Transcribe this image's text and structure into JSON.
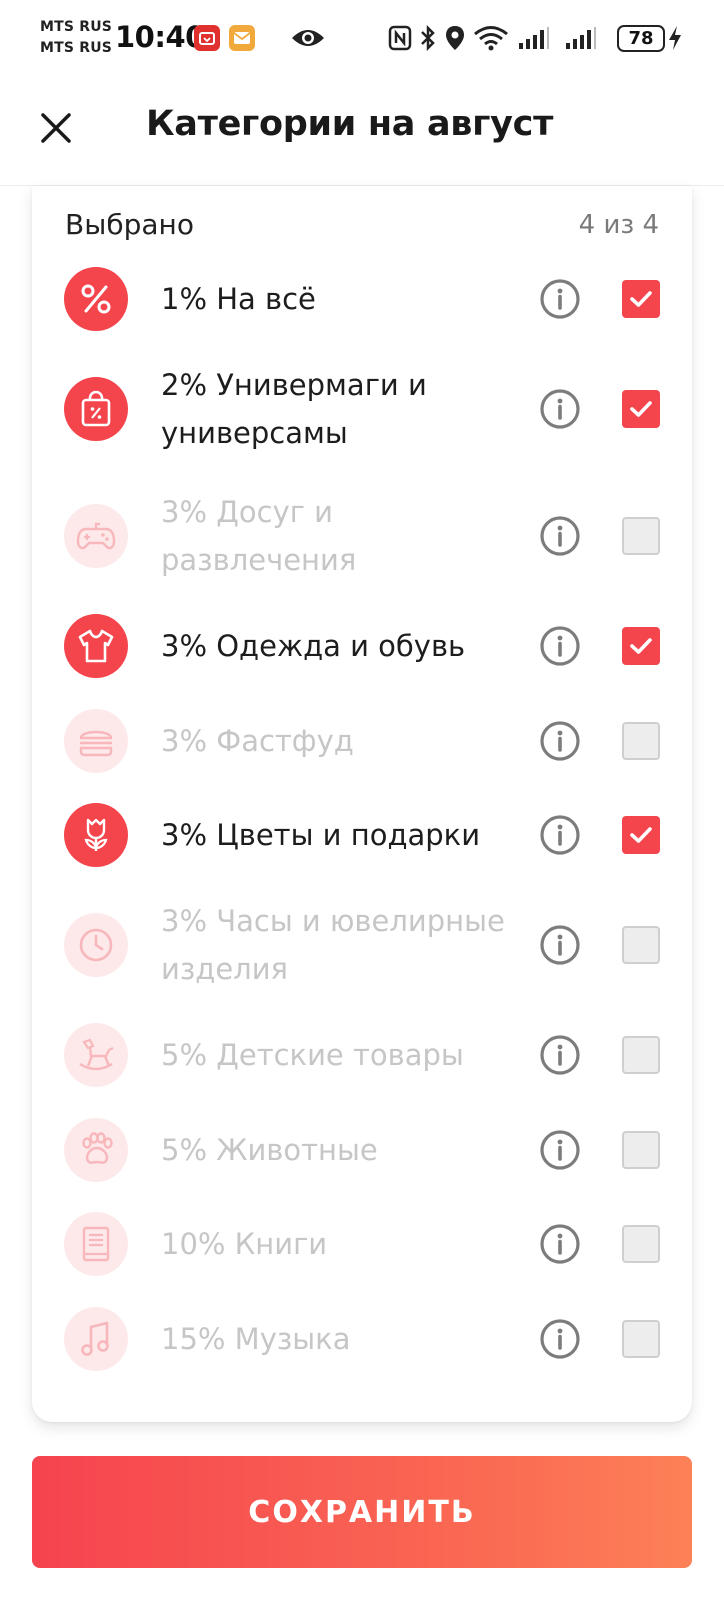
{
  "status_bar": {
    "carrier_1": "MTS RUS",
    "carrier_2": "MTS RUS",
    "time": "10:40",
    "battery": "78",
    "icons": [
      "mtapp-notification-icon",
      "mail-notification-icon",
      "eye-icon",
      "nfc-icon",
      "bluetooth-icon",
      "location-icon",
      "wifi-icon",
      "signal-icon",
      "signal-icon",
      "charging-icon"
    ]
  },
  "header": {
    "title": "Категории на август",
    "close_icon": "close-icon"
  },
  "selection": {
    "label": "Выбрано",
    "count": "4 из 4"
  },
  "categories": [
    {
      "label": "1% На всё",
      "icon": "percent-icon",
      "checked": true
    },
    {
      "label": "2% Универмаги и универсамы",
      "icon": "shopping-bag-icon",
      "checked": true
    },
    {
      "label": "3% Досуг и развлечения",
      "icon": "gamepad-icon",
      "checked": false
    },
    {
      "label": "3% Одежда и обувь",
      "icon": "tshirt-icon",
      "checked": true
    },
    {
      "label": "3% Фастфуд",
      "icon": "burger-icon",
      "checked": false
    },
    {
      "label": "3% Цветы и подарки",
      "icon": "flower-icon",
      "checked": true
    },
    {
      "label": "3% Часы и ювелирные изделия",
      "icon": "clock-icon",
      "checked": false
    },
    {
      "label": "5% Детские товары",
      "icon": "rocking-horse-icon",
      "checked": false
    },
    {
      "label": "5% Животные",
      "icon": "paw-icon",
      "checked": false
    },
    {
      "label": "10% Книги",
      "icon": "book-icon",
      "checked": false
    },
    {
      "label": "15% Музыка",
      "icon": "music-note-icon",
      "checked": false
    }
  ],
  "colors": {
    "accent": "#f4444c",
    "accent_light": "#fde9ea",
    "disabled_text": "#c6c6c6",
    "button_gradient_start": "#f6434f",
    "button_gradient_end": "#fd8157"
  },
  "footer": {
    "save_label": "СОХРАНИТЬ"
  }
}
